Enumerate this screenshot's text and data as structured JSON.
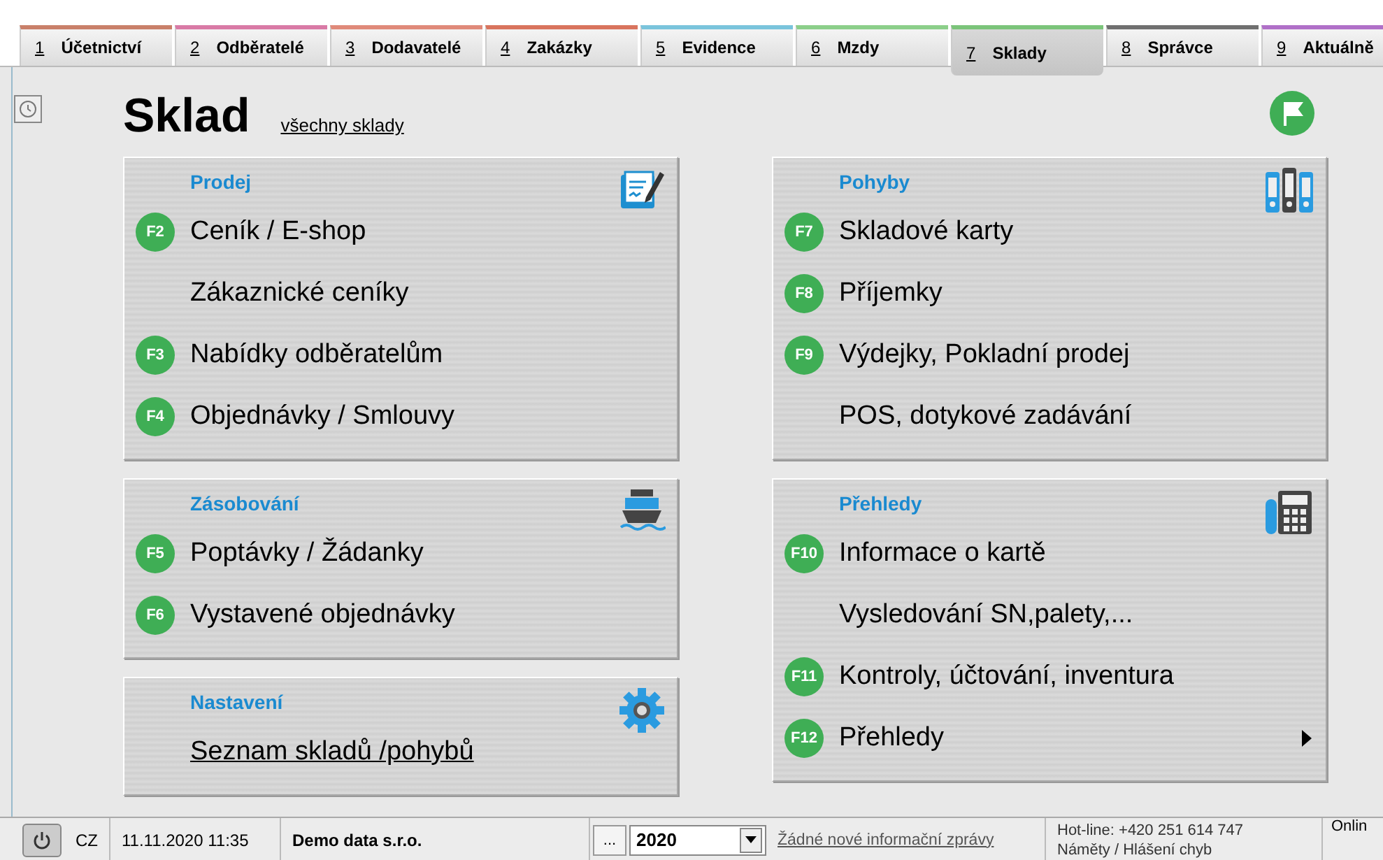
{
  "tabs": [
    {
      "number": "1",
      "label": "Účetnictví",
      "color": "#c9806a",
      "selected": false
    },
    {
      "number": "2",
      "label": "Odběratelé",
      "color": "#d97aa6",
      "selected": false
    },
    {
      "number": "3",
      "label": "Dodavatelé",
      "color": "#e08a7a",
      "selected": false
    },
    {
      "number": "4",
      "label": "Zakázky",
      "color": "#d9745e",
      "selected": false
    },
    {
      "number": "5",
      "label": "Evidence",
      "color": "#7ac4dc",
      "selected": false
    },
    {
      "number": "6",
      "label": "Mzdy",
      "color": "#8ccf8a",
      "selected": false
    },
    {
      "number": "7",
      "label": "Sklady",
      "color": "#7bc47a",
      "selected": true
    },
    {
      "number": "8",
      "label": "Správce",
      "color": "#707070",
      "selected": false
    },
    {
      "number": "9",
      "label": "Aktuálně",
      "color": "#b070c8",
      "selected": false
    }
  ],
  "page": {
    "title": "Sklad",
    "link": "všechny sklady"
  },
  "columns": [
    {
      "panels": [
        {
          "title": "Prodej",
          "items": [
            {
              "key": "F2",
              "label": "Ceník / E-shop",
              "kind": "command"
            },
            {
              "label": "Zákaznické ceníky",
              "kind": "command"
            },
            {
              "key": "F3",
              "label": "Nabídky odběratelům",
              "kind": "command"
            },
            {
              "key": "F4",
              "label": "Objednávky / Smlouvy",
              "kind": "command"
            }
          ]
        },
        {
          "title": "Zásobování",
          "items": [
            {
              "key": "F5",
              "label": "Poptávky / Žádanky",
              "kind": "command"
            },
            {
              "key": "F6",
              "label": "Vystavené objednávky",
              "kind": "command"
            }
          ]
        },
        {
          "title": "Nastavení",
          "items": [
            {
              "label": "Seznam skladů /pohybů",
              "kind": "link"
            }
          ]
        }
      ]
    },
    {
      "panels": [
        {
          "title": "Pohyby",
          "items": [
            {
              "key": "F7",
              "label": "Skladové karty",
              "kind": "command"
            },
            {
              "key": "F8",
              "label": "Příjemky",
              "kind": "command"
            },
            {
              "key": "F9",
              "label": "Výdejky, Pokladní prodej",
              "kind": "command"
            },
            {
              "label": "POS, dotykové zadávání",
              "kind": "command"
            }
          ]
        },
        {
          "title": "Přehledy",
          "items": [
            {
              "key": "F10",
              "label": "Informace o kartě",
              "kind": "command"
            },
            {
              "label": "Vysledování SN,palety,...",
              "kind": "command"
            },
            {
              "key": "F11",
              "label": "Kontroly, účtování, inventura",
              "kind": "command"
            },
            {
              "key": "F12",
              "label": "Přehledy",
              "kind": "submenu"
            }
          ]
        }
      ]
    }
  ],
  "status_bar": {
    "language": "CZ",
    "datetime": "11.11.2020 11:35",
    "company": "Demo data s.r.o.",
    "more_button": "...",
    "year": "2020",
    "messages": "Žádné nové informační zprávy",
    "hotline": "Hot-line: +420 251 614 747",
    "feedback": "Náměty / Hlášení chyb",
    "online": "Onlin"
  }
}
